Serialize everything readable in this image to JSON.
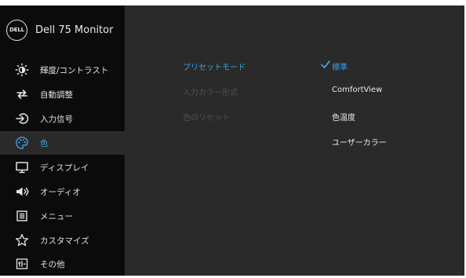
{
  "header": {
    "title": "Dell 75 Monitor",
    "logo_text": "DELL"
  },
  "sidebar": {
    "items": [
      {
        "label": "輝度/コントラスト",
        "icon": "brightness-icon"
      },
      {
        "label": "自動調整",
        "icon": "auto-adjust-icon"
      },
      {
        "label": "入力信号",
        "icon": "input-source-icon"
      },
      {
        "label": "色",
        "icon": "color-palette-icon"
      },
      {
        "label": "ディスプレイ",
        "icon": "display-icon"
      },
      {
        "label": "オーディオ",
        "icon": "speaker-icon"
      },
      {
        "label": "メニュー",
        "icon": "menu-icon"
      },
      {
        "label": "カスタマイズ",
        "icon": "star-icon"
      },
      {
        "label": "その他",
        "icon": "others-icon"
      }
    ],
    "active_index": 3
  },
  "submenu": {
    "items": [
      {
        "label": "プリセットモード"
      },
      {
        "label": "入力カラー形式"
      },
      {
        "label": "色のリセット"
      }
    ]
  },
  "options": {
    "items": [
      {
        "label": "標準"
      },
      {
        "label": "ComfortView"
      },
      {
        "label": "色温度"
      },
      {
        "label": "ユーザーカラー"
      }
    ]
  },
  "colors": {
    "accent": "#3aa0dc",
    "sidebar_bg": "#0b0b0b",
    "panel_bg": "#2a2a2a",
    "text": "#e2e2e2"
  }
}
